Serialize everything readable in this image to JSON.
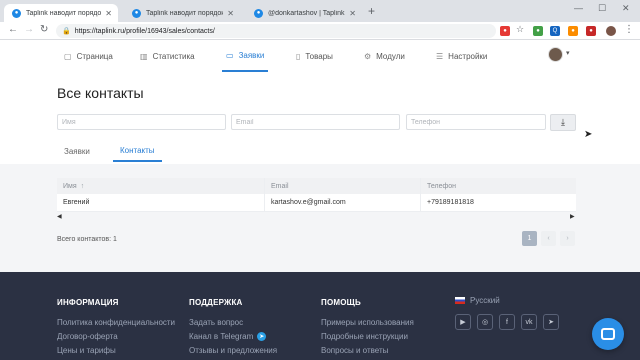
{
  "browser": {
    "tabs": [
      {
        "label": "Taplink наводит порядок в Insta",
        "active": true
      },
      {
        "label": "Taplink наводит порядок в Insta",
        "active": false
      },
      {
        "label": "@donkartashov | Taplink.cc",
        "active": false
      }
    ],
    "url": "https://taplink.ru/profile/16943/sales/contacts/"
  },
  "nav": {
    "items": [
      {
        "label": "Страница",
        "icon": "page-icon"
      },
      {
        "label": "Статистика",
        "icon": "stats-icon"
      },
      {
        "label": "Заявки",
        "icon": "inbox-icon",
        "active": true
      },
      {
        "label": "Товары",
        "icon": "products-icon"
      },
      {
        "label": "Модули",
        "icon": "modules-icon"
      },
      {
        "label": "Настройки",
        "icon": "settings-icon"
      }
    ]
  },
  "page": {
    "title": "Все контакты",
    "filters": {
      "name_placeholder": "Имя",
      "email_placeholder": "Email",
      "phone_placeholder": "Телефон"
    },
    "subtabs": [
      {
        "label": "Заявки",
        "active": false
      },
      {
        "label": "Контакты",
        "active": true
      }
    ]
  },
  "table": {
    "columns": [
      "Имя",
      "Email",
      "Телефон"
    ],
    "rows": [
      {
        "name": "Евгений",
        "email": "kartashov.e@gmail.com",
        "phone": "+79189181818"
      }
    ],
    "total_label": "Всего контактов: 1",
    "current_page": "1"
  },
  "footer": {
    "col1": {
      "title": "ИНФОРМАЦИЯ",
      "links": [
        "Политика конфиденциальности",
        "Договор-оферта",
        "Цены и тарифы"
      ]
    },
    "col2": {
      "title": "ПОДДЕРЖКА",
      "links": [
        "Задать вопрос",
        "Канал в Telegram",
        "Отзывы и предложения"
      ]
    },
    "col3": {
      "title": "ПОМОЩЬ",
      "links": [
        "Примеры использования",
        "Подробные инструкции",
        "Вопросы и ответы"
      ]
    },
    "language": "Русский"
  },
  "colors": {
    "accent": "#2a7fd4",
    "footer_bg": "#2b3143",
    "chat": "#2a8ee6"
  }
}
